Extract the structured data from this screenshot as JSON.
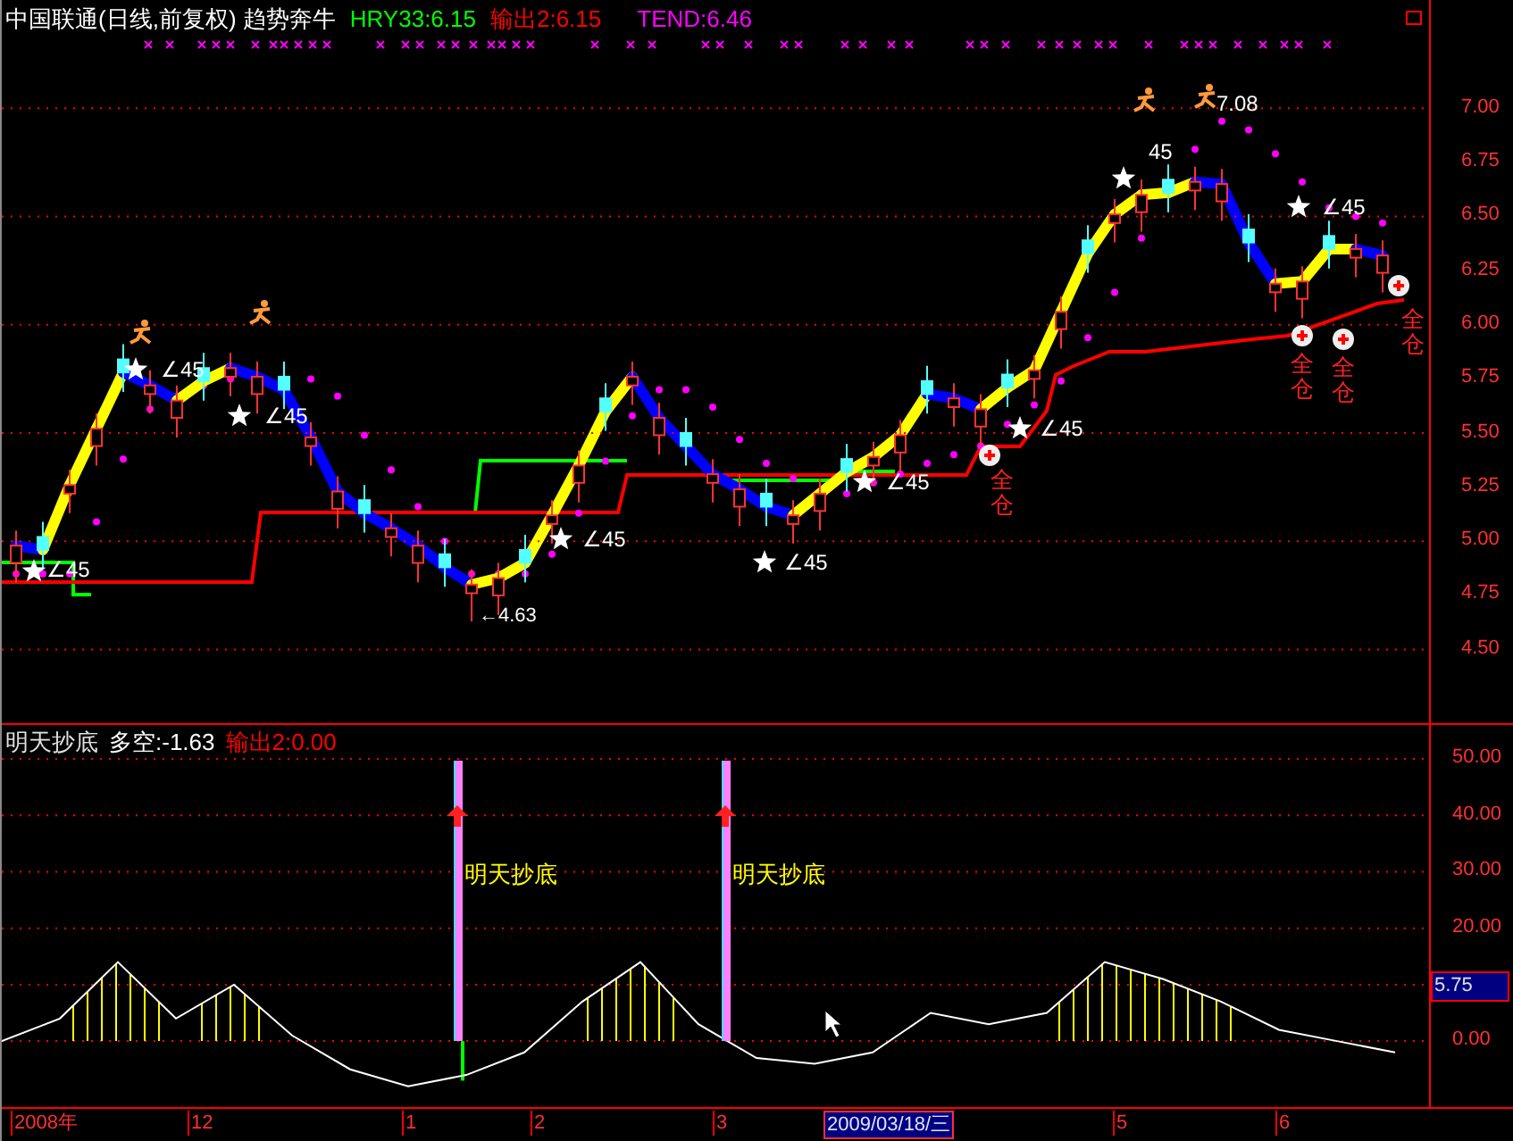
{
  "header": {
    "title": "中国联通(日线,前复权) 趋势奔牛",
    "indicators": [
      {
        "text": "HRY33:6.15",
        "color": "#00ff00"
      },
      {
        "text": "输出2:6.15",
        "color": "#ff0000"
      },
      {
        "text": "TEND:6.46",
        "color": "#ff00ff"
      }
    ]
  },
  "price_chart": {
    "chart_data": {
      "type": "candlestick",
      "ohlc": [
        [
          4.9,
          5.05,
          4.81,
          4.98
        ],
        [
          5.02,
          5.09,
          4.87,
          4.96
        ],
        [
          5.22,
          5.33,
          5.13,
          5.26
        ],
        [
          5.44,
          5.59,
          5.35,
          5.52
        ],
        [
          5.84,
          5.91,
          5.69,
          5.78
        ],
        [
          5.68,
          5.79,
          5.59,
          5.72
        ],
        [
          5.57,
          5.72,
          5.48,
          5.65
        ],
        [
          5.8,
          5.87,
          5.65,
          5.74
        ],
        [
          5.76,
          5.87,
          5.67,
          5.8
        ],
        [
          5.68,
          5.83,
          5.59,
          5.76
        ],
        [
          5.76,
          5.83,
          5.61,
          5.7
        ],
        [
          5.44,
          5.55,
          5.35,
          5.48
        ],
        [
          5.15,
          5.3,
          5.06,
          5.23
        ],
        [
          5.19,
          5.26,
          5.04,
          5.13
        ],
        [
          5.02,
          5.13,
          4.93,
          5.06
        ],
        [
          4.9,
          5.05,
          4.81,
          4.98
        ],
        [
          4.94,
          5.01,
          4.79,
          4.88
        ],
        [
          4.76,
          4.87,
          4.63,
          4.8
        ],
        [
          4.75,
          4.9,
          4.66,
          4.83
        ],
        [
          4.96,
          5.03,
          4.81,
          4.9
        ],
        [
          5.08,
          5.19,
          4.99,
          5.12
        ],
        [
          5.27,
          5.42,
          5.18,
          5.35
        ],
        [
          5.66,
          5.73,
          5.51,
          5.6
        ],
        [
          5.72,
          5.83,
          5.63,
          5.76
        ],
        [
          5.49,
          5.64,
          5.4,
          5.57
        ],
        [
          5.5,
          5.57,
          5.35,
          5.44
        ],
        [
          5.27,
          5.38,
          5.18,
          5.31
        ],
        [
          5.16,
          5.31,
          5.07,
          5.24
        ],
        [
          5.22,
          5.29,
          5.07,
          5.16
        ],
        [
          5.08,
          5.19,
          4.99,
          5.12
        ],
        [
          5.14,
          5.29,
          5.05,
          5.22
        ],
        [
          5.38,
          5.45,
          5.23,
          5.32
        ],
        [
          5.35,
          5.46,
          5.26,
          5.39
        ],
        [
          5.41,
          5.56,
          5.32,
          5.49
        ],
        [
          5.74,
          5.81,
          5.59,
          5.68
        ],
        [
          5.62,
          5.73,
          5.53,
          5.66
        ],
        [
          5.53,
          5.68,
          5.44,
          5.61
        ],
        [
          5.77,
          5.84,
          5.62,
          5.71
        ],
        [
          5.75,
          5.86,
          5.66,
          5.79
        ],
        [
          5.98,
          6.13,
          5.89,
          6.06
        ],
        [
          6.39,
          6.46,
          6.24,
          6.33
        ],
        [
          6.47,
          6.58,
          6.38,
          6.51
        ],
        [
          6.52,
          6.67,
          6.43,
          6.6
        ],
        [
          6.67,
          6.74,
          6.52,
          6.61
        ],
        [
          6.62,
          6.73,
          6.53,
          6.66
        ],
        [
          6.57,
          6.72,
          6.48,
          6.65
        ],
        [
          6.44,
          6.51,
          6.29,
          6.38
        ],
        [
          6.15,
          6.26,
          6.06,
          6.19
        ],
        [
          6.12,
          6.27,
          6.03,
          6.2
        ],
        [
          6.41,
          6.48,
          6.26,
          6.35
        ],
        [
          6.31,
          6.42,
          6.22,
          6.35
        ],
        [
          6.24,
          6.39,
          6.15,
          6.32
        ]
      ],
      "grid": true,
      "ylim": [
        4.16,
        7.5
      ],
      "yticks": [
        {
          "value": 7,
          "label": "7.00"
        },
        {
          "value": 6.75,
          "label": "6.75"
        },
        {
          "value": 6.5,
          "label": "6.50"
        },
        {
          "value": 6.25,
          "label": "6.25"
        },
        {
          "value": 6,
          "label": "6.00"
        },
        {
          "value": 5.75,
          "label": "5.75"
        },
        {
          "value": 5.5,
          "label": "5.50"
        },
        {
          "value": 5.25,
          "label": "5.25"
        },
        {
          "value": 5,
          "label": "5.00"
        },
        {
          "value": 4.75,
          "label": "4.75"
        },
        {
          "value": 4.5,
          "label": "4.50"
        }
      ]
    }
  },
  "annotations": [
    {
      "kind": "angle",
      "text": "∠45"
    },
    {
      "kind": "angle",
      "text": "∠45"
    },
    {
      "kind": "angle",
      "text": "∠45"
    },
    {
      "kind": "angle",
      "text": "∠45"
    },
    {
      "kind": "angle",
      "text": "∠45"
    },
    {
      "kind": "angle",
      "text": "∠45"
    },
    {
      "kind": "angle",
      "text": "∠45"
    },
    {
      "kind": "angle",
      "text": "45"
    },
    {
      "kind": "angle",
      "text": "∠45"
    },
    {
      "kind": "low",
      "text": "←4.63"
    },
    {
      "kind": "high",
      "text": "7.08"
    },
    {
      "kind": "position",
      "text": "全仓"
    },
    {
      "kind": "position",
      "text": "全仓"
    },
    {
      "kind": "position",
      "text": "全仓"
    },
    {
      "kind": "position",
      "text": "全仓"
    }
  ],
  "lower_panel": {
    "title": "明天抄底",
    "indicators": [
      {
        "text": "多空:-1.63",
        "color": "#ffffff"
      },
      {
        "text": "输出2:0.00",
        "color": "#ff0000"
      }
    ],
    "signals": [
      {
        "text": "明天抄底"
      },
      {
        "text": "明天抄底"
      }
    ],
    "chart_data": {
      "type": "line",
      "grid": true,
      "series": [
        {
          "color": "#ffffff",
          "values": [
            0,
            4,
            14,
            4,
            10,
            1,
            -5,
            -8,
            -6,
            -2,
            7,
            14,
            3,
            -3,
            -4,
            -2,
            5,
            3,
            5,
            14,
            11,
            7,
            2,
            0,
            -2
          ]
        }
      ],
      "ylim": [
        -12,
        56
      ],
      "yticks": [
        {
          "value": 50,
          "label": "50.00"
        },
        {
          "value": 40,
          "label": "40.00"
        },
        {
          "value": 30,
          "label": "30.00"
        },
        {
          "value": 20,
          "label": "20.00"
        },
        {
          "value": 0,
          "label": "0.00"
        }
      ]
    },
    "current": "5.75"
  },
  "time_axis": {
    "labels": [
      {
        "text": "2008年",
        "selected": false
      },
      {
        "text": "12",
        "selected": false
      },
      {
        "text": "1",
        "selected": false
      },
      {
        "text": "2",
        "selected": false
      },
      {
        "text": "3",
        "selected": false
      },
      {
        "text": "2009/03/18/三",
        "selected": true
      },
      {
        "text": "5",
        "selected": false
      },
      {
        "text": "6",
        "selected": false
      }
    ]
  }
}
